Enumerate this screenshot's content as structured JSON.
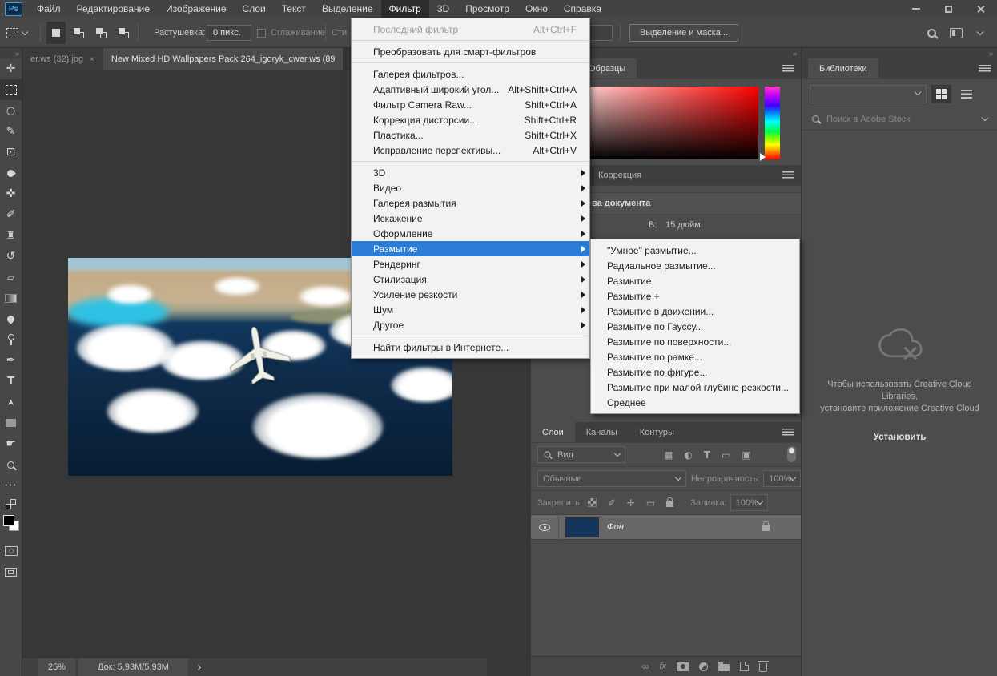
{
  "colors": {
    "menu_highlight": "#2a7cd6",
    "panel_bg": "#4c4c4c",
    "pasteboard": "#373737",
    "menu_bg": "#f2f2f2",
    "ps_logo_blue": "#3ba0f2"
  },
  "app": {
    "logo": "Ps"
  },
  "menubar": {
    "items": [
      {
        "label": "Файл"
      },
      {
        "label": "Редактирование"
      },
      {
        "label": "Изображение"
      },
      {
        "label": "Слои"
      },
      {
        "label": "Текст"
      },
      {
        "label": "Выделение"
      },
      {
        "label": "Фильтр",
        "active": true
      },
      {
        "label": "3D"
      },
      {
        "label": "Просмотр"
      },
      {
        "label": "Окно"
      },
      {
        "label": "Справка"
      }
    ]
  },
  "options_bar": {
    "feather_label": "Растушевка:",
    "feather_value": "0 пикс.",
    "antialias_label": "Сглаживание",
    "style_label_fragment": "Сти",
    "select_and_mask_button": "Выделение и маска..."
  },
  "document_tabs": {
    "tab1": {
      "title": "er.ws (32).jpg",
      "close": "×"
    },
    "tab2": {
      "title": "New Mixed HD Wallpapers Pack 264_igoryk_cwer.ws (89"
    }
  },
  "filter_menu": {
    "items": [
      {
        "label": "Последний фильтр",
        "shortcut": "Alt+Ctrl+F",
        "disabled": true
      },
      {
        "separator": true
      },
      {
        "label": "Преобразовать для смарт-фильтров"
      },
      {
        "separator": true
      },
      {
        "label": "Галерея фильтров..."
      },
      {
        "label": "Адаптивный широкий угол...",
        "shortcut": "Alt+Shift+Ctrl+A"
      },
      {
        "label": "Фильтр Camera Raw...",
        "shortcut": "Shift+Ctrl+A"
      },
      {
        "label": "Коррекция дисторсии...",
        "shortcut": "Shift+Ctrl+R"
      },
      {
        "label": "Пластика...",
        "shortcut": "Shift+Ctrl+X"
      },
      {
        "label": "Исправление перспективы...",
        "shortcut": "Alt+Ctrl+V"
      },
      {
        "separator": true
      },
      {
        "label": "3D",
        "submenu": true
      },
      {
        "label": "Видео",
        "submenu": true
      },
      {
        "label": "Галерея размытия",
        "submenu": true
      },
      {
        "label": "Искажение",
        "submenu": true
      },
      {
        "label": "Оформление",
        "submenu": true
      },
      {
        "label": "Размытие",
        "submenu": true,
        "highlighted": true
      },
      {
        "label": "Рендеринг",
        "submenu": true
      },
      {
        "label": "Стилизация",
        "submenu": true
      },
      {
        "label": "Усиление резкости",
        "submenu": true
      },
      {
        "label": "Шум",
        "submenu": true
      },
      {
        "label": "Другое",
        "submenu": true
      },
      {
        "separator": true
      },
      {
        "label": "Найти фильтры в Интернете..."
      }
    ]
  },
  "blur_submenu": {
    "items": [
      "\"Умное\" размытие...",
      "Радиальное размытие...",
      "Размытие",
      "Размытие +",
      "Размытие в движении...",
      "Размытие по Гауссу...",
      "Размытие по поверхности...",
      "Размытие по рамке...",
      "Размытие по фигуре...",
      "Размытие при малой глубине резкости...",
      "Среднее"
    ]
  },
  "color_panel": {
    "tab": "Образцы"
  },
  "properties_panel": {
    "tab": "Коррекция",
    "section_fragment": "ва документа",
    "height_label": "В:",
    "height_value": "15 дюйм"
  },
  "layers_panel": {
    "tabs": [
      {
        "label": "Слои",
        "active": true
      },
      {
        "label": "Каналы"
      },
      {
        "label": "Контуры"
      }
    ],
    "filter_search_label": "Вид",
    "blend_mode": "Обычные",
    "opacity_label": "Непрозрачность:",
    "opacity_value": "100%",
    "lock_label": "Закрепить:",
    "fill_label": "Заливка:",
    "fill_value": "100%",
    "layer": {
      "name": "Фон"
    }
  },
  "libraries_panel": {
    "tab": "Библиотеки",
    "search_placeholder": "Поиск в Adobe Stock",
    "message_lines": [
      "Чтобы использовать Creative Cloud",
      "Libraries,",
      "установите приложение Creative Cloud"
    ],
    "install_link": "Установить"
  },
  "status_bar": {
    "zoom_level": "25%",
    "doc_info": "Док: 5,93М/5,93М"
  }
}
